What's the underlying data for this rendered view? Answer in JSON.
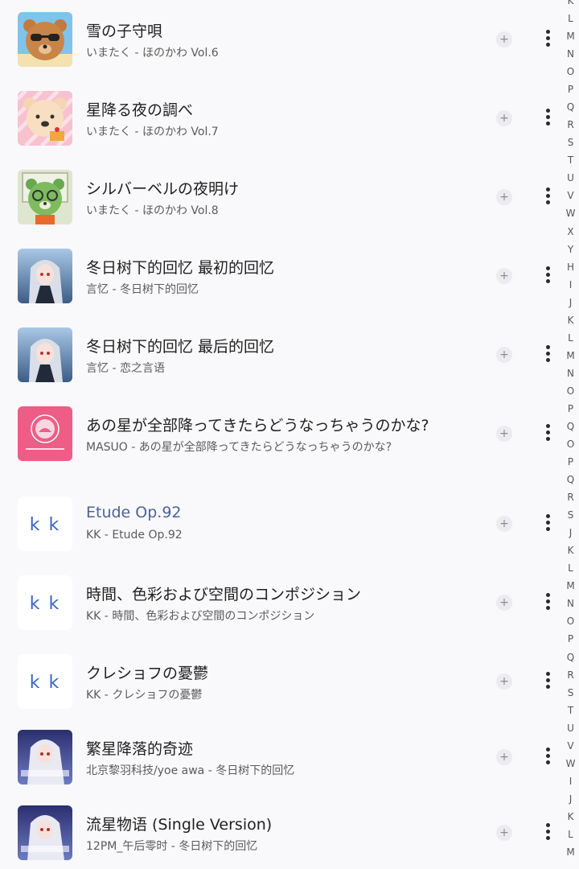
{
  "songs": [
    {
      "title": "雪の子守唄",
      "subtitle": "いまたく - ほのかわ Vol.6",
      "art": "bear-sunglasses-art",
      "accent": false
    },
    {
      "title": "星降る夜の調べ",
      "subtitle": "いまたく - ほのかわ Vol.7",
      "art": "bear-cake-art",
      "accent": false
    },
    {
      "title": "シルバーベルの夜明け",
      "subtitle": "いまたく - ほのかわ Vol.8",
      "art": "bear-glasses-art",
      "accent": false
    },
    {
      "title": "冬日树下的回忆 最初的回忆",
      "subtitle": "言忆 - 冬日树下的回忆",
      "art": "anime-girl-art",
      "accent": false
    },
    {
      "title": "冬日树下的回忆 最后的回忆",
      "subtitle": "言忆 - 恋之言语",
      "art": "anime-girl-art",
      "accent": false
    },
    {
      "title": "あの星が全部降ってきたらどうなっちゃうのかな?",
      "subtitle": "MASUO - あの星が全部降ってきたらどうなっちゃうのかな?",
      "art": "pink-badge-art",
      "accent": false
    },
    {
      "title": "Etude Op.92",
      "subtitle": "KK - Etude Op.92",
      "art": "kk-logo-art",
      "accent": true
    },
    {
      "title": "時間、色彩および空間のコンポジション",
      "subtitle": "KK - 時間、色彩および空間のコンポジション",
      "art": "kk-logo-art",
      "accent": false
    },
    {
      "title": "クレショフの憂鬱",
      "subtitle": "KK - クレショフの憂鬱",
      "art": "kk-logo-art",
      "accent": false
    },
    {
      "title": "繁星降落的奇迹",
      "subtitle": "北京黎羽科技/yoe awa - 冬日树下的回忆",
      "art": "anime-night-art",
      "accent": false
    },
    {
      "title": "流星物语 (Single Version)",
      "subtitle": "12PM_午后零时 - 冬日树下的回忆",
      "art": "anime-night-art",
      "accent": false
    }
  ],
  "row_actions": {
    "add_label": "+"
  },
  "alpha_index": [
    "K",
    "L",
    "M",
    "N",
    "O",
    "P",
    "Q",
    "R",
    "S",
    "T",
    "U",
    "V",
    "W",
    "X",
    "Y",
    "H",
    "I",
    "J",
    "K",
    "L",
    "M",
    "N",
    "O",
    "P",
    "Q",
    "O",
    "P",
    "Q",
    "R",
    "S",
    "J",
    "K",
    "L",
    "M",
    "N",
    "O",
    "P",
    "Q",
    "R",
    "S",
    "T",
    "U",
    "V",
    "W",
    "I",
    "J",
    "K",
    "L",
    "M"
  ],
  "kk_logo_text": "k k",
  "colors": {
    "accent": "#4e6296",
    "background": "#f9f9fb"
  }
}
